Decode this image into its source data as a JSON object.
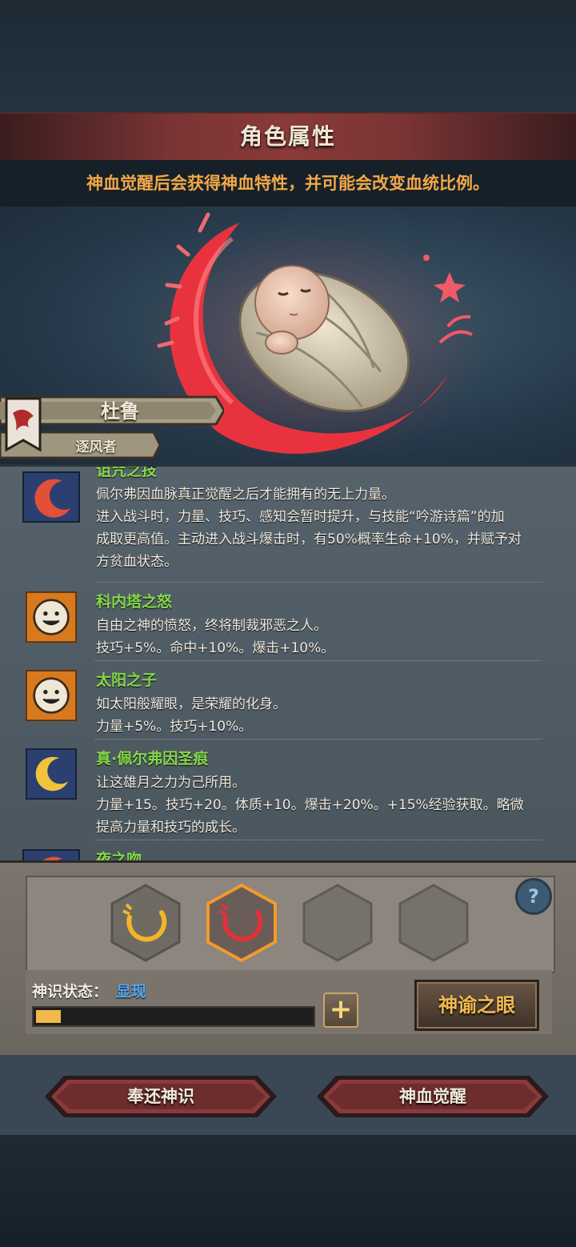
{
  "header": {
    "title": "角色属性",
    "subtitle": "神血觉醒后会获得神血特性，并可能会改变血统比例。"
  },
  "character": {
    "name": "杜鲁",
    "class": "逐风者"
  },
  "traits": [
    {
      "name": "诅咒之技",
      "icon": "red-crescent-icon",
      "lines": [
        "佩尔弗因血脉真正觉醒之后才能拥有的无上力量。",
        "进入战斗时，力量、技巧、感知会暂时提升，与技能“吟游诗篇”的加",
        "成取更高值。主动进入战斗爆击时，有50%概率生命+10%，并赋予对",
        "方贫血状态。"
      ]
    },
    {
      "name": "科内塔之怒",
      "icon": "sun-face-icon",
      "lines": [
        "自由之神的愤怒，终将制裁邪恶之人。",
        "技巧+5%。命中+10%。爆击+10%。"
      ]
    },
    {
      "name": "太阳之子",
      "icon": "sun-face-icon",
      "lines": [
        "如太阳般耀眼，是荣耀的化身。",
        "力量+5%。技巧+10%。"
      ]
    },
    {
      "name": "真·佩尔弗因圣痕",
      "icon": "gold-crescent-icon",
      "lines": [
        "让这雄月之力为己所用。",
        "力量+15。技巧+20。体质+10。爆击+20%。+15%经验获取。略微",
        "提高力量和技巧的成长。"
      ]
    },
    {
      "name": "夜之吻",
      "icon": "red-crescent-icon",
      "lines": []
    }
  ],
  "slots": [
    {
      "state": "gold",
      "icon": "gold-swirl-icon"
    },
    {
      "state": "red-selected",
      "icon": "red-swirl-icon"
    },
    {
      "state": "empty"
    },
    {
      "state": "empty"
    }
  ],
  "status": {
    "label": "神识状态：",
    "value": "显现",
    "progress": 0.09,
    "oracle_button": "神谕之眼",
    "help": "?",
    "plus": "+"
  },
  "actions": {
    "return_label": "奉还神识",
    "awaken_label": "神血觉醒"
  },
  "colors": {
    "trait_name": "#86d84b",
    "subtitle": "#f2a748",
    "status_value": "#52a7f0",
    "accent_red": "#e0323a"
  }
}
